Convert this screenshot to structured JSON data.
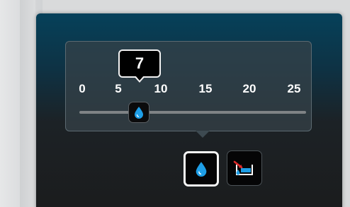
{
  "slider": {
    "ticks": [
      "0",
      "5",
      "10",
      "15",
      "20",
      "25"
    ],
    "min": 0,
    "max": 25,
    "value": 7,
    "value_label": "7",
    "thumb_icon": "water-drop-icon"
  },
  "mode_buttons": [
    {
      "icon": "water-drop-icon",
      "selected": true
    },
    {
      "icon": "tank-fill-icon",
      "selected": false
    }
  ],
  "colors": {
    "accent_blue": "#1e9ee6",
    "warning_red": "#e02a2a",
    "panel_top": "#06415a",
    "panel_bottom": "#1b1c1d"
  }
}
